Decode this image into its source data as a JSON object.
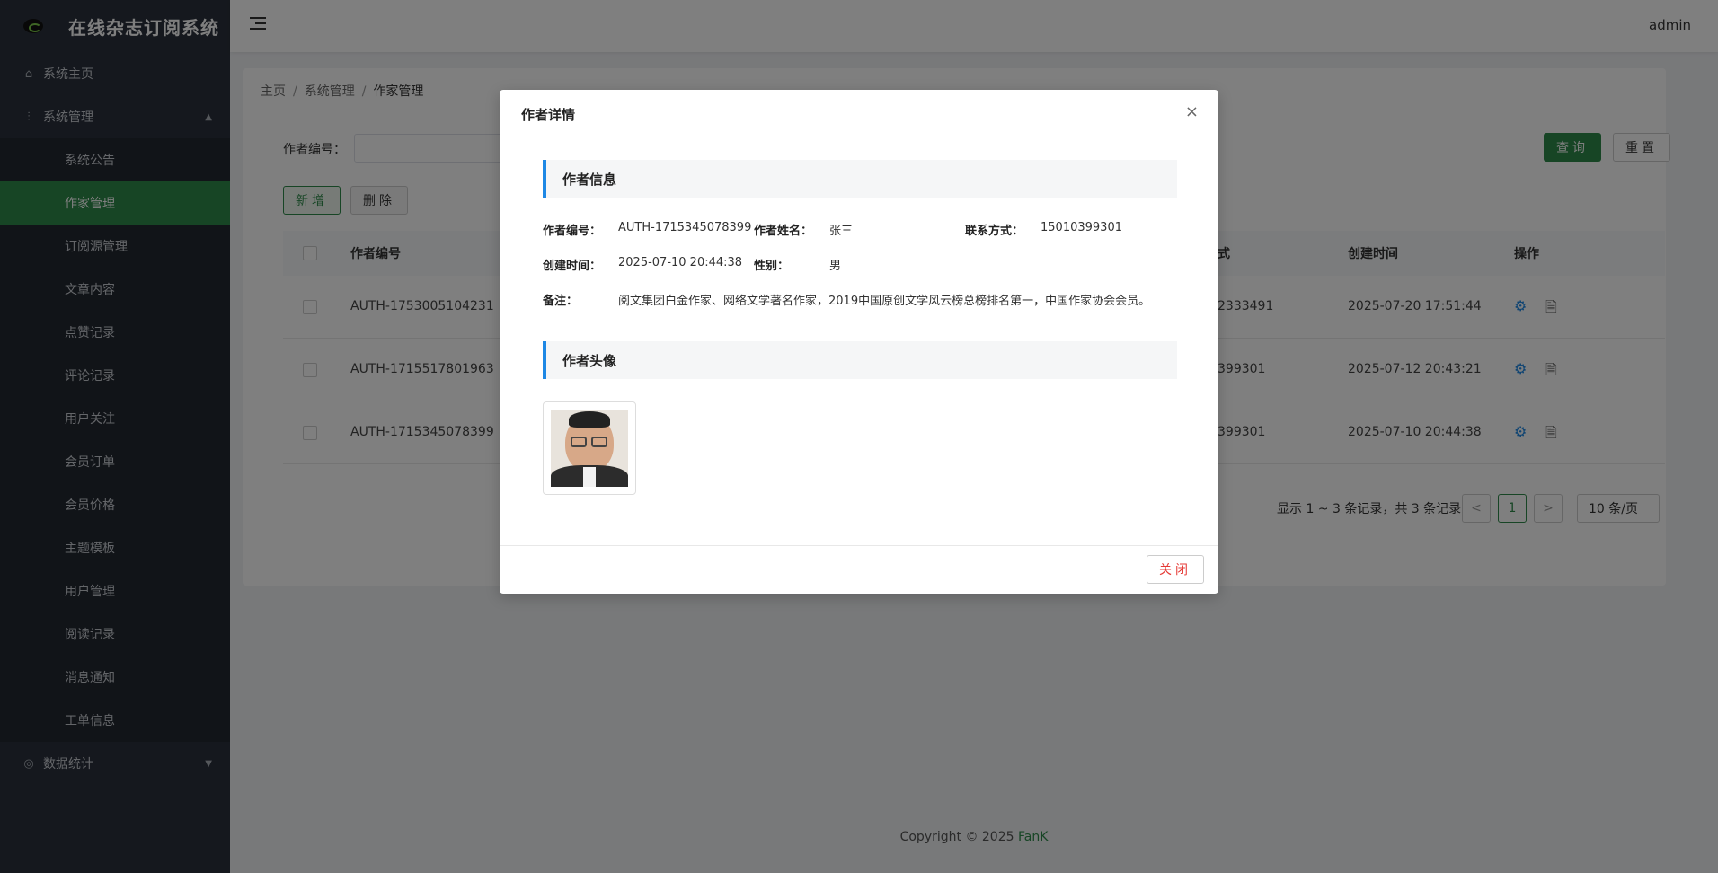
{
  "app": {
    "title": "在线杂志订阅系统",
    "user": "admin"
  },
  "sidebar": {
    "home": "系统主页",
    "system": "系统管理",
    "sub_items": [
      "系统公告",
      "作家管理",
      "订阅源管理",
      "文章内容",
      "点赞记录",
      "评论记录",
      "用户关注",
      "会员订单",
      "会员价格",
      "主题模板",
      "用户管理",
      "阅读记录",
      "消息通知",
      "工单信息"
    ],
    "stats": "数据统计"
  },
  "breadcrumb": {
    "home": "主页",
    "sep": "/",
    "section": "系统管理",
    "current": "作家管理"
  },
  "search": {
    "label": "作者编号：",
    "placeholder": ""
  },
  "buttons": {
    "query": "查询",
    "reset": "重置",
    "add": "新增",
    "delete": "删除"
  },
  "table": {
    "columns": {
      "id": "作者编号",
      "phone": "式",
      "created": "创建时间",
      "ops": "操作"
    },
    "rows": [
      {
        "id": "AUTH-1753005104231",
        "phone": "2333491",
        "created": "2025-07-20 17:51:44"
      },
      {
        "id": "AUTH-1715517801963",
        "phone": "399301",
        "created": "2025-07-12 20:43:21"
      },
      {
        "id": "AUTH-1715345078399",
        "phone": "399301",
        "created": "2025-07-10 20:44:38"
      }
    ]
  },
  "pagination": {
    "summary": "显示 1 ~ 3 条记录，共 3 条记录",
    "prev": "<",
    "page": "1",
    "next": ">",
    "size": "10 条/页"
  },
  "footer": {
    "copyright": "Copyright © 2025 ",
    "brand": "FanK"
  },
  "modal": {
    "title": "作者详情",
    "close_icon": "×",
    "section_info": "作者信息",
    "fields": {
      "id_label": "作者编号：",
      "id_value": "AUTH-1715345078399",
      "name_label": "作者姓名：",
      "name_value": "张三",
      "contact_label": "联系方式：",
      "contact_value": "15010399301",
      "created_label": "创建时间：",
      "created_value": "2025-07-10 20:44:38",
      "gender_label": "性别：",
      "gender_value": "男",
      "remark_label": "备注：",
      "remark_value": "阅文集团白金作家、网络文学著名作家，2019中国原创文学风云榜总榜排名第一，中国作家协会会员。"
    },
    "section_avatar": "作者头像",
    "close_button": "关闭"
  },
  "colors": {
    "accent": "#2e8b4a",
    "sidebar": "#2b313c",
    "info_bar": "#1e88e5",
    "danger": "#e53935"
  }
}
